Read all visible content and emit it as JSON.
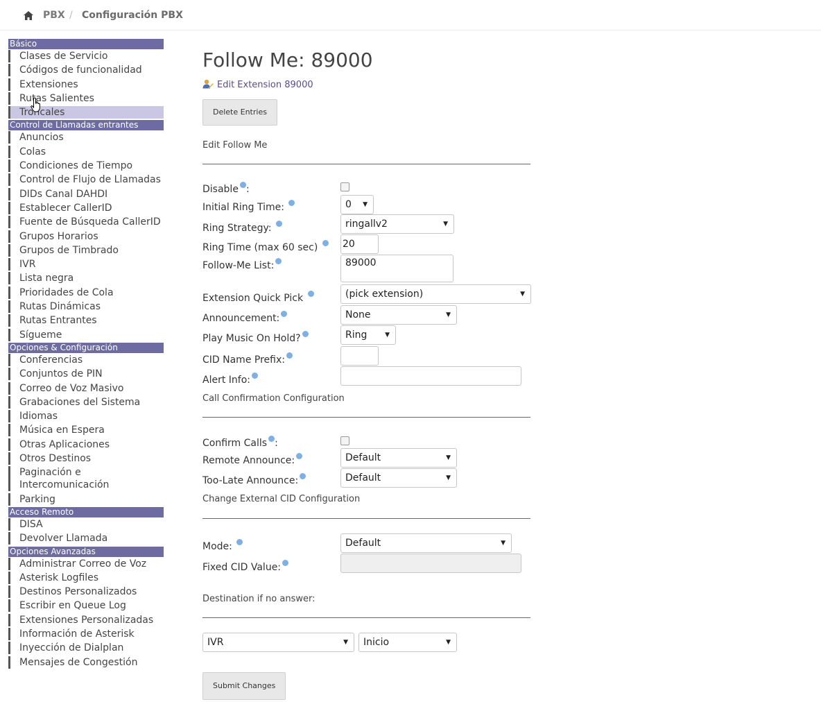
{
  "breadcrumb": {
    "home_icon": "home-icon",
    "items": [
      "PBX",
      "Configuración PBX"
    ],
    "separator": "/"
  },
  "sidebar": {
    "groups": [
      {
        "header": "Básico",
        "items": [
          "Clases de Servicio",
          "Códigos de funcionalidad",
          "Extensiones",
          "Rutas Salientes",
          "Troncales"
        ]
      },
      {
        "header": "Control de Llamadas entrantes",
        "items": [
          "Anuncios",
          "Colas",
          "Condiciones de Tiempo",
          "Control de Flujo de Llamadas",
          "DIDs Canal DAHDI",
          "Establecer CallerID",
          "Fuente de Búsqueda CallerID",
          "Grupos Horarios",
          "Grupos de Timbrado",
          "IVR",
          "Lista negra",
          "Prioridades de Cola",
          "Rutas Dinámicas",
          "Rutas Entrantes",
          "Sígueme"
        ]
      },
      {
        "header": "Opciones & Configuración",
        "items": [
          "Conferencias",
          "Conjuntos de PIN",
          "Correo de Voz Masivo",
          "Grabaciones del Sistema",
          "Idiomas",
          "Música en Espera",
          "Otras Aplicaciones",
          "Otros Destinos",
          "Paginación e Intercomunicación",
          "Parking"
        ]
      },
      {
        "header": "Acceso Remoto",
        "items": [
          "DISA",
          "Devolver Llamada"
        ]
      },
      {
        "header": "Opciones Avanzadas",
        "items": [
          "Administrar Correo de Voz",
          "Asterisk Logfiles",
          "Destinos Personalizados",
          "Escribir en Queue Log",
          "Extensiones Personalizadas",
          "Información de Asterisk",
          "Inyección de Dialplan",
          "Mensajes de Congestión"
        ]
      }
    ],
    "active_item": "Troncales"
  },
  "main": {
    "title": "Follow Me: 89000",
    "edit_link": "Edit Extension 89000",
    "delete_button": "Delete Entries",
    "section_edit": "Edit Follow Me",
    "disable_label": "Disable",
    "initial_ring_time_label": "Initial Ring Time:",
    "initial_ring_time_value": "0",
    "ring_strategy_label": "Ring Strategy:",
    "ring_strategy_value": "ringallv2",
    "ring_time_label": "Ring Time (max 60 sec)",
    "ring_time_value": "20",
    "followme_list_label": "Follow-Me List:",
    "followme_list_value": "89000",
    "quick_pick_label": "Extension Quick Pick",
    "quick_pick_value": "(pick extension)",
    "announcement_label": "Announcement:",
    "announcement_value": "None",
    "moh_label": "Play Music On Hold?",
    "moh_value": "Ring",
    "cid_prefix_label": "CID Name Prefix:",
    "cid_prefix_value": "",
    "alert_info_label": "Alert Info:",
    "alert_info_value": "",
    "section_call_confirm": "Call Confirmation Configuration",
    "confirm_calls_label": "Confirm Calls",
    "remote_announce_label": "Remote Announce:",
    "remote_announce_value": "Default",
    "too_late_label": "Too-Late Announce:",
    "too_late_value": "Default",
    "section_external_cid": "Change External CID Configuration",
    "mode_label": "Mode:",
    "mode_value": "Default",
    "fixed_cid_label": "Fixed CID Value:",
    "fixed_cid_value": "",
    "section_destination": "Destination if no answer:",
    "dest_type_value": "IVR",
    "dest_target_value": "Inicio",
    "submit_button": "Submit Changes",
    "colon": ":"
  }
}
